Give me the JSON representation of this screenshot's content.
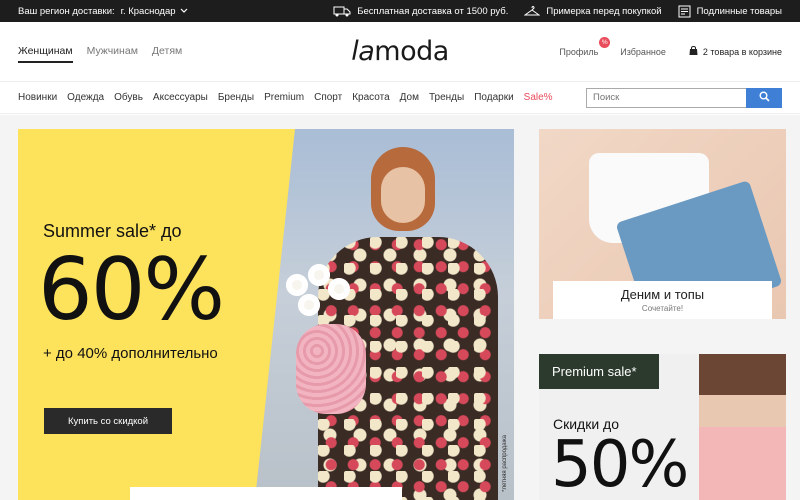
{
  "topbar": {
    "region_label": "Ваш регион доставки:",
    "region_city": "г. Краснодар",
    "delivery": "Бесплатная доставка от 1500 руб.",
    "fitting": "Примерка перед покупкой",
    "gift": "Подлинные товары"
  },
  "header": {
    "gender_tabs": [
      "Женщинам",
      "Мужчинам",
      "Детям"
    ],
    "logo_la": "la",
    "logo_moda": "moda",
    "profile": "Профиль",
    "profile_badge": "%",
    "favorites": "Избранное",
    "cart": "2 товара в корзине"
  },
  "nav": {
    "items": [
      "Новинки",
      "Одежда",
      "Обувь",
      "Аксессуары",
      "Бренды",
      "Premium",
      "Спорт",
      "Красота",
      "Дом",
      "Тренды",
      "Подарки",
      "Sale%"
    ],
    "search_placeholder": "Поиск"
  },
  "hero": {
    "line1": "Summer sale* до",
    "big": "60%",
    "line2": "+ до 40% дополнительно",
    "cta": "Купить со скидкой",
    "vertical": "*летняя распродажа"
  },
  "card1": {
    "title": "Деним и топы",
    "subtitle": "Сочетайте!"
  },
  "card2": {
    "tag": "Premium sale*",
    "discount": "Скидки до",
    "big": "50%"
  }
}
